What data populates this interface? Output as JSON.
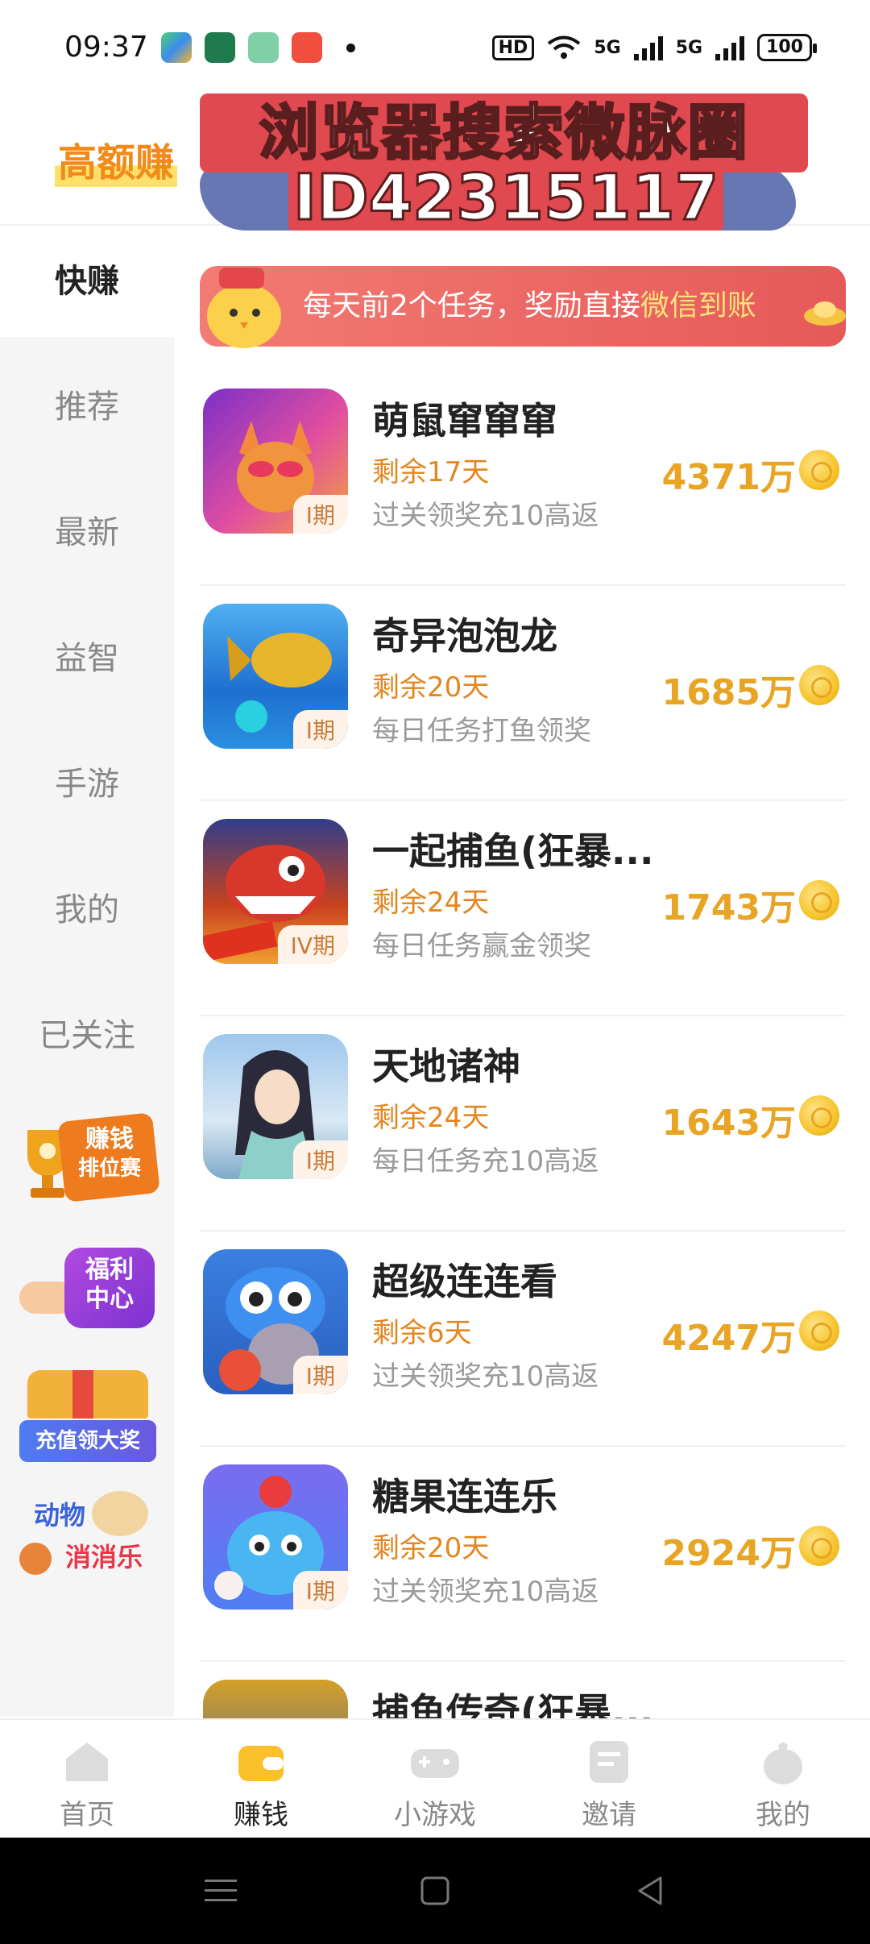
{
  "status_bar": {
    "time": "09:37",
    "hd_label": "HD",
    "net1": "5G",
    "net2": "5G",
    "battery": "100"
  },
  "header": {
    "title": "高额赚",
    "overlay_line1": "浏览器搜索微脉圈",
    "overlay_line2": "ID42315117"
  },
  "sidebar": {
    "items": [
      {
        "label": "快赚",
        "active": true
      },
      {
        "label": "推荐"
      },
      {
        "label": "最新"
      },
      {
        "label": "益智"
      },
      {
        "label": "手游"
      },
      {
        "label": "我的"
      },
      {
        "label": "已关注"
      }
    ],
    "promos": [
      {
        "line1": "赚钱",
        "line2": "排位赛"
      },
      {
        "line1": "福利",
        "line2": "中心"
      },
      {
        "line1": "充值领大奖"
      },
      {
        "line1": "动物",
        "line2": "消消乐"
      }
    ]
  },
  "banner": {
    "text_prefix": "每天前2个任务，奖励直接",
    "text_highlight": "微信到账"
  },
  "games": [
    {
      "name": "萌鼠窜窜窜",
      "period": "I期",
      "remaining": "剩余17天",
      "desc": "过关领奖充10高返",
      "reward": "4371万"
    },
    {
      "name": "奇异泡泡龙",
      "period": "I期",
      "remaining": "剩余20天",
      "desc": "每日任务打鱼领奖",
      "reward": "1685万"
    },
    {
      "name": "一起捕鱼(狂暴...",
      "period": "IV期",
      "remaining": "剩余24天",
      "desc": "每日任务赢金领奖",
      "reward": "1743万"
    },
    {
      "name": "天地诸神",
      "period": "I期",
      "remaining": "剩余24天",
      "desc": "每日任务充10高返",
      "reward": "1643万"
    },
    {
      "name": "超级连连看",
      "period": "I期",
      "remaining": "剩余6天",
      "desc": "过关领奖充10高返",
      "reward": "4247万"
    },
    {
      "name": "糖果连连乐",
      "period": "I期",
      "remaining": "剩余20天",
      "desc": "过关领奖充10高返",
      "reward": "2924万"
    },
    {
      "name": "捕鱼传奇(狂暴..."
    }
  ],
  "bottom_nav": [
    {
      "label": "首页"
    },
    {
      "label": "赚钱",
      "active": true
    },
    {
      "label": "小游戏"
    },
    {
      "label": "邀请"
    },
    {
      "label": "我的"
    }
  ],
  "colors": {
    "accent_orange": "#e3861f",
    "reward_gold": "#e8a425",
    "banner_red": "#e65959"
  }
}
